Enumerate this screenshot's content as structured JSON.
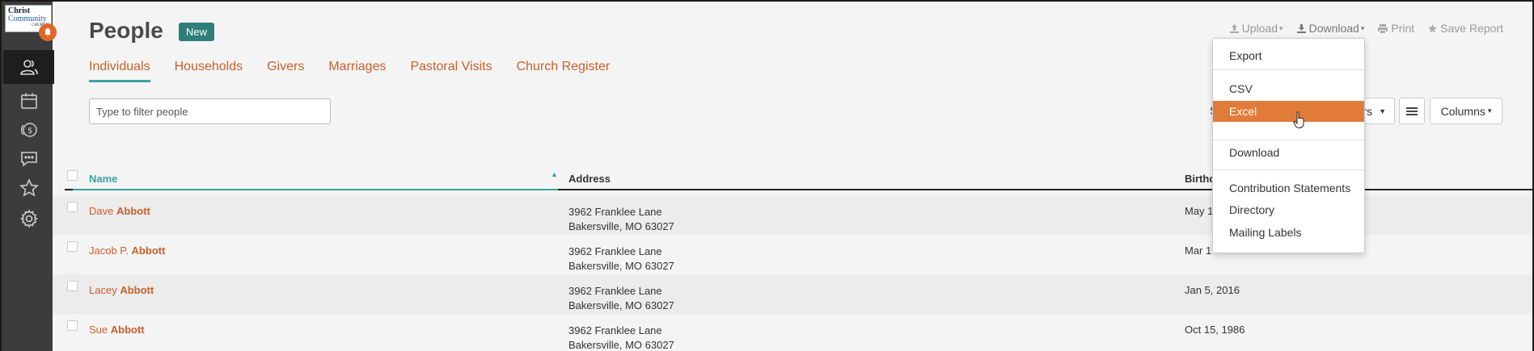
{
  "sidebar": {
    "logo": {
      "line1": "Christ",
      "line2": "Community",
      "line3": "CHURCH"
    },
    "items": [
      {
        "name": "people",
        "icon": "people-icon"
      },
      {
        "name": "calendar",
        "icon": "calendar-icon"
      },
      {
        "name": "giving",
        "icon": "giving-icon"
      },
      {
        "name": "messages",
        "icon": "chat-icon"
      },
      {
        "name": "favorites",
        "icon": "star-icon"
      },
      {
        "name": "settings",
        "icon": "gear-icon"
      }
    ]
  },
  "header": {
    "title": "People",
    "badge": "New"
  },
  "tabs": [
    "Individuals",
    "Households",
    "Givers",
    "Marriages",
    "Pastoral Visits",
    "Church Register"
  ],
  "filter": {
    "placeholder": "Type to filter people"
  },
  "toolbar": {
    "upload": "Upload",
    "download": "Download",
    "print": "Print",
    "save_report": "Save Report"
  },
  "buttons": {
    "filters_fragment": "ers",
    "columns": "Columns",
    "partial_s": "S"
  },
  "dropdown": {
    "export_header": "Export",
    "csv": "CSV",
    "excel": "Excel",
    "download": "Download",
    "contribution": "Contribution Statements",
    "directory": "Directory",
    "mailing": "Mailing Labels"
  },
  "table": {
    "headers": {
      "name": "Name",
      "address": "Address",
      "birthday": "Birthd"
    },
    "rows": [
      {
        "first": "Dave",
        "last": "Abbott",
        "addr1": "3962 Franklee Lane",
        "addr2": "Bakersville, MO  63027",
        "bday": "May 1"
      },
      {
        "first": "Jacob P.",
        "last": "Abbott",
        "addr1": "3962 Franklee Lane",
        "addr2": "Bakersville, MO  63027",
        "bday": "Mar 1"
      },
      {
        "first": "Lacey",
        "last": "Abbott",
        "addr1": "3962 Franklee Lane",
        "addr2": "Bakersville, MO  63027",
        "bday": "Jan 5, 2016"
      },
      {
        "first": "Sue",
        "last": "Abbott",
        "addr1": "3962 Franklee Lane",
        "addr2": "Bakersville, MO  63027",
        "bday": "Oct 15, 1986"
      }
    ]
  },
  "colors": {
    "accent": "#c8602a",
    "teal": "#3aa39f",
    "highlight": "#e07b39",
    "sidebar": "#3c3c3c"
  }
}
